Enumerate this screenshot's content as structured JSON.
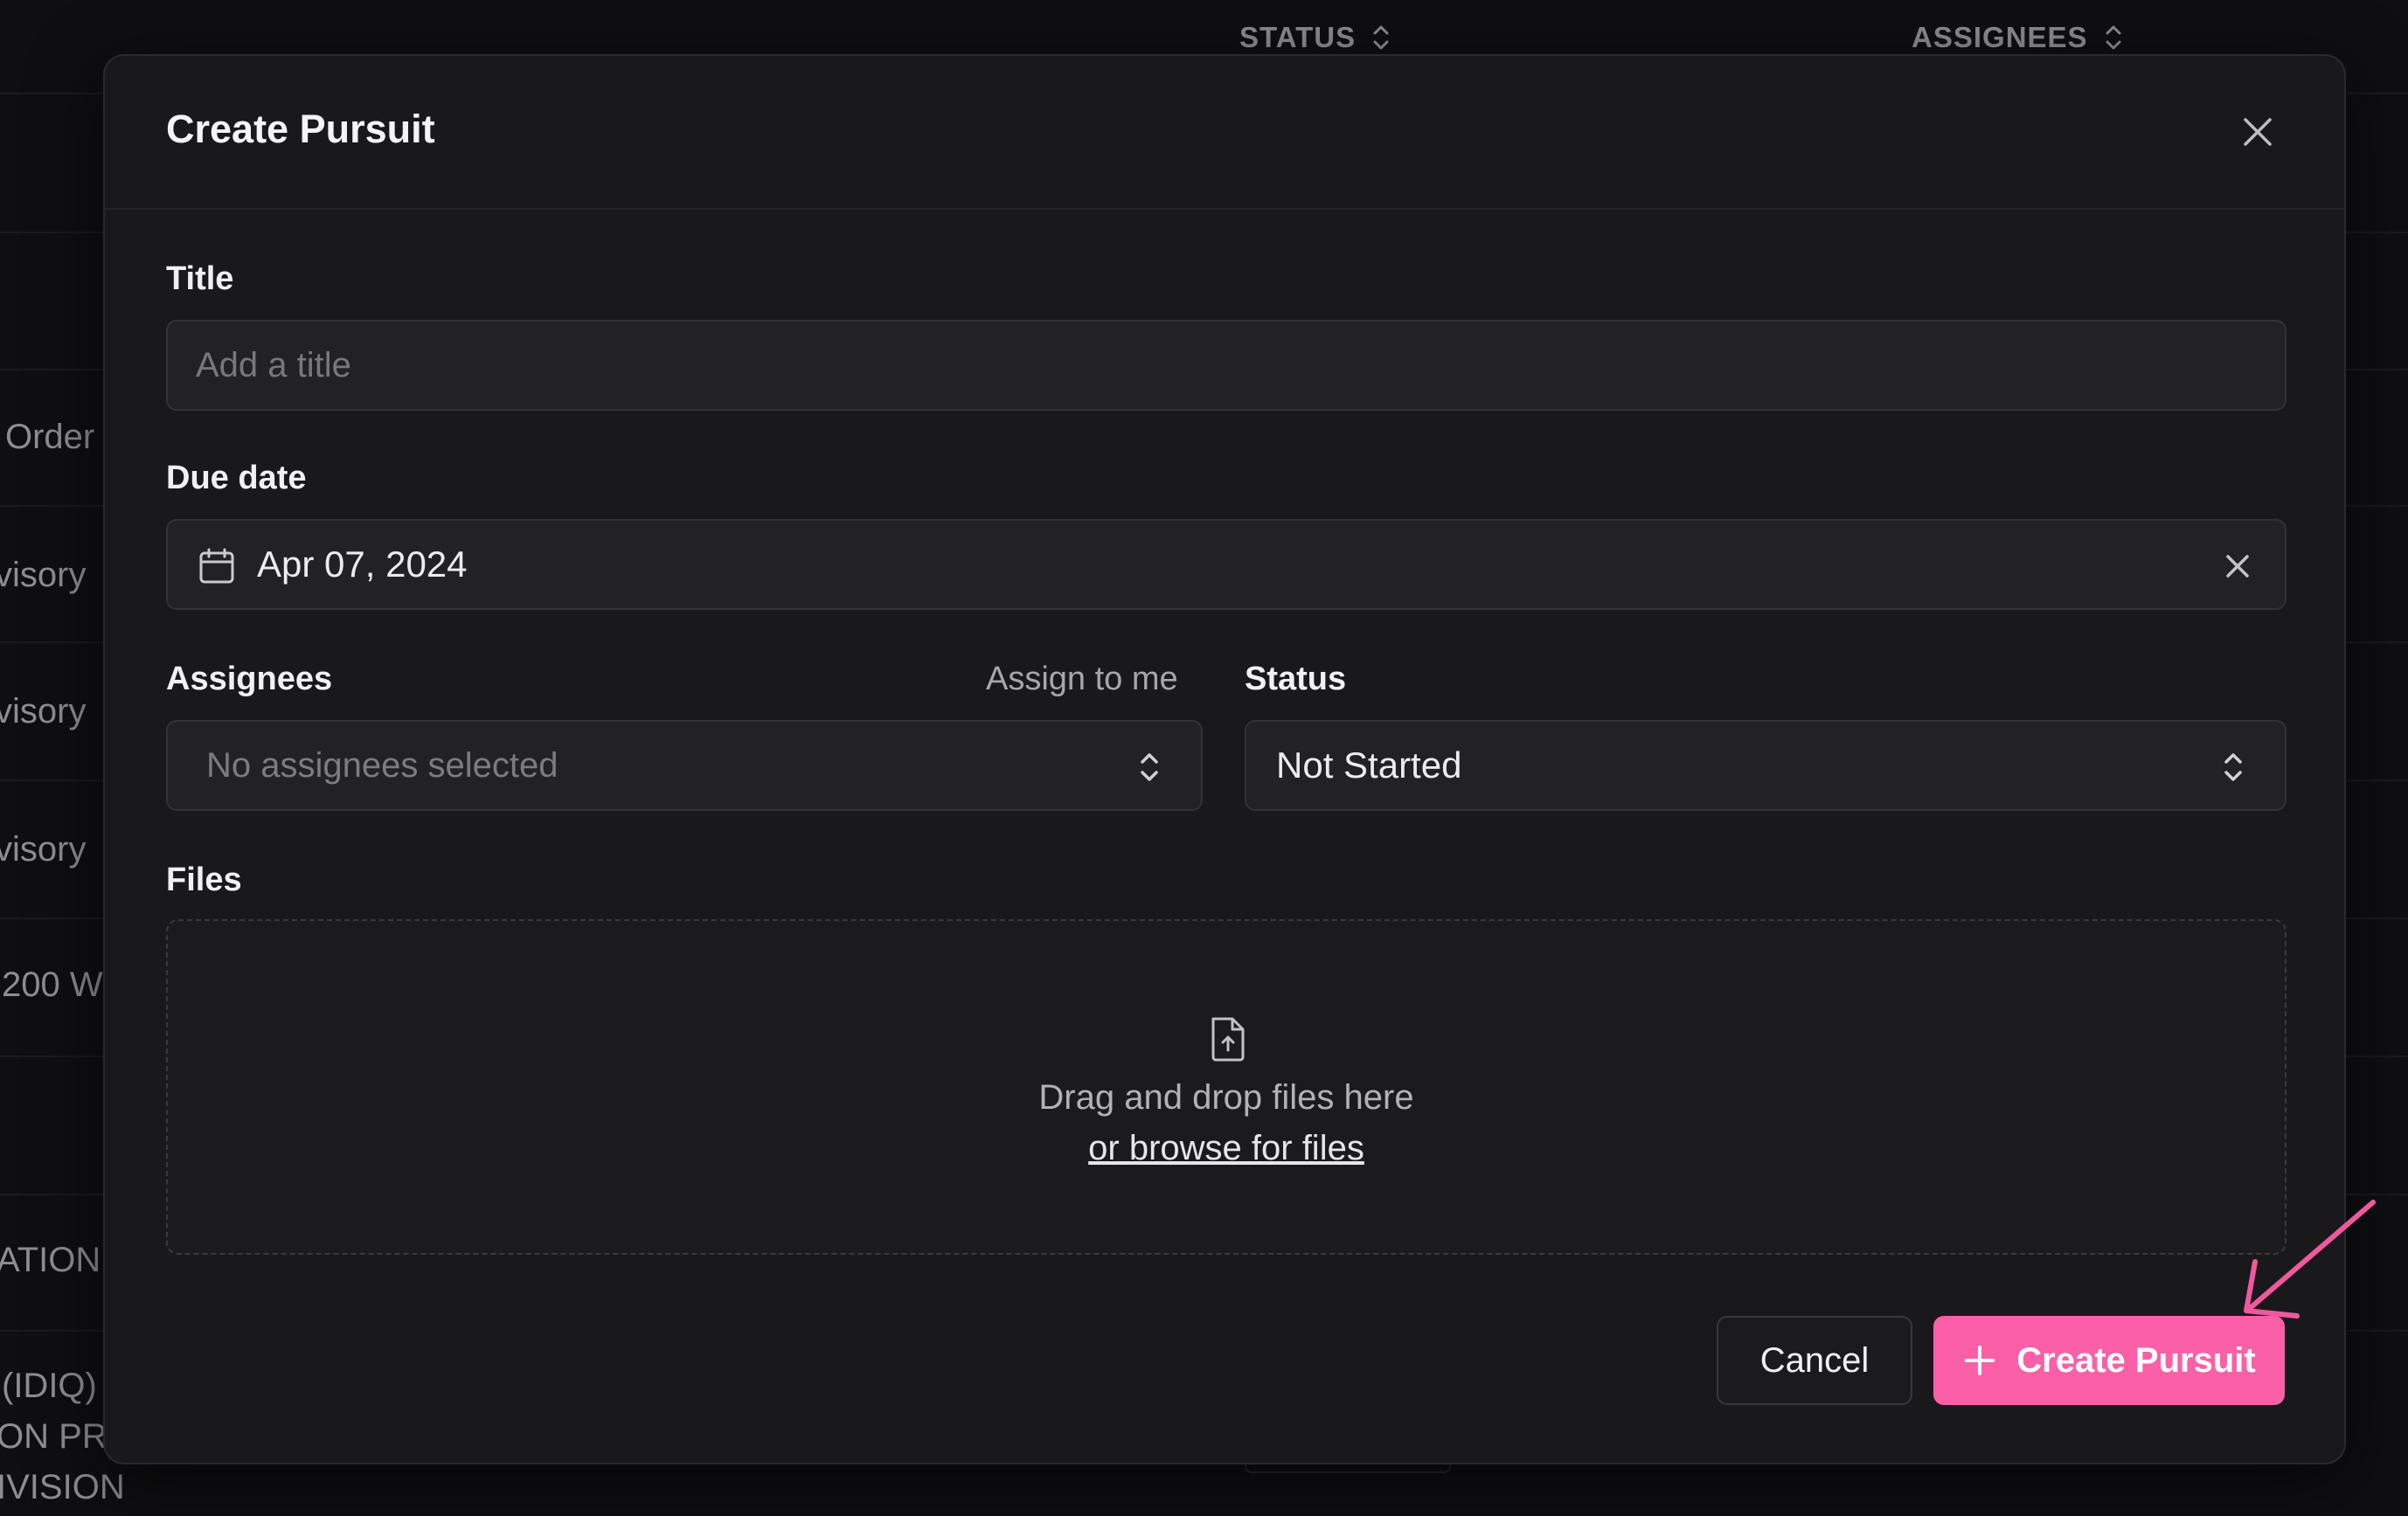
{
  "background": {
    "columns": [
      "STATUS",
      "ASSIGNEES"
    ],
    "row_fragments": [
      "Order",
      "visory",
      "visory",
      "visory",
      "200 W",
      "ATION",
      "(IDIQ)",
      "ON PRO",
      "IVISION"
    ]
  },
  "modal": {
    "title": "Create Pursuit",
    "title_field": {
      "label": "Title",
      "placeholder": "Add a title",
      "value": ""
    },
    "due_date": {
      "label": "Due date",
      "value": "Apr 07, 2024"
    },
    "assignees": {
      "label": "Assignees",
      "assign_to_me": "Assign to me",
      "placeholder": "No assignees selected"
    },
    "status": {
      "label": "Status",
      "value": "Not Started"
    },
    "files": {
      "label": "Files",
      "drop_text": "Drag and drop files here",
      "browse_link": "or browse for files"
    },
    "buttons": {
      "cancel": "Cancel",
      "create": "Create Pursuit"
    }
  },
  "colors": {
    "accent": "#fa5fa8",
    "modal_bg": "#19191b",
    "field_bg": "#222225"
  },
  "icons": [
    "close-icon",
    "calendar-icon",
    "clear-icon",
    "chevron-updown-icon",
    "file-upload-icon",
    "plus-icon"
  ]
}
